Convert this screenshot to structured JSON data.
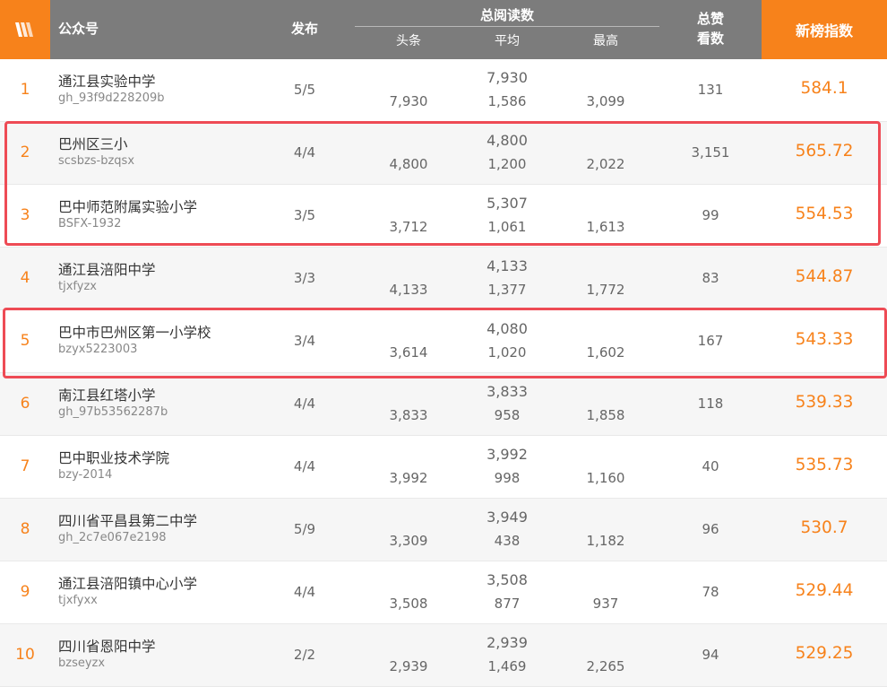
{
  "header": {
    "logo_icon": "w-logo-icon",
    "account_label": "公众号",
    "publish_label": "发布",
    "total_reads_label": "总阅读数",
    "headline_label": "头条",
    "average_label": "平均",
    "max_label": "最高",
    "likes_label_1": "总赞",
    "likes_label_2": "看数",
    "index_label": "新榜指数"
  },
  "colors": {
    "accent": "#f7821b",
    "header_bg": "#7c7c7c",
    "highlight": "#ee4b55"
  },
  "rows": [
    {
      "rank": "1",
      "name": "通江县实验中学",
      "account": "gh_93f9d228209b",
      "publish": "5/5",
      "total": "7,930",
      "headline": "7,930",
      "average": "1,586",
      "max": "3,099",
      "likes": "131",
      "score": "584.1"
    },
    {
      "rank": "2",
      "name": "巴州区三小",
      "account": "scsbzs-bzqsx",
      "publish": "4/4",
      "total": "4,800",
      "headline": "4,800",
      "average": "1,200",
      "max": "2,022",
      "likes": "3,151",
      "score": "565.72"
    },
    {
      "rank": "3",
      "name": "巴中师范附属实验小学",
      "account": "BSFX-1932",
      "publish": "3/5",
      "total": "5,307",
      "headline": "3,712",
      "average": "1,061",
      "max": "1,613",
      "likes": "99",
      "score": "554.53"
    },
    {
      "rank": "4",
      "name": "通江县涪阳中学",
      "account": "tjxfyzx",
      "publish": "3/3",
      "total": "4,133",
      "headline": "4,133",
      "average": "1,377",
      "max": "1,772",
      "likes": "83",
      "score": "544.87"
    },
    {
      "rank": "5",
      "name": "巴中市巴州区第一小学校",
      "account": "bzyx5223003",
      "publish": "3/4",
      "total": "4,080",
      "headline": "3,614",
      "average": "1,020",
      "max": "1,602",
      "likes": "167",
      "score": "543.33"
    },
    {
      "rank": "6",
      "name": "南江县红塔小学",
      "account": "gh_97b53562287b",
      "publish": "4/4",
      "total": "3,833",
      "headline": "3,833",
      "average": "958",
      "max": "1,858",
      "likes": "118",
      "score": "539.33"
    },
    {
      "rank": "7",
      "name": "巴中职业技术学院",
      "account": "bzy-2014",
      "publish": "4/4",
      "total": "3,992",
      "headline": "3,992",
      "average": "998",
      "max": "1,160",
      "likes": "40",
      "score": "535.73"
    },
    {
      "rank": "8",
      "name": "四川省平昌县第二中学",
      "account": "gh_2c7e067e2198",
      "publish": "5/9",
      "total": "3,949",
      "headline": "3,309",
      "average": "438",
      "max": "1,182",
      "likes": "96",
      "score": "530.7"
    },
    {
      "rank": "9",
      "name": "通江县涪阳镇中心小学",
      "account": "tjxfyxx",
      "publish": "4/4",
      "total": "3,508",
      "headline": "3,508",
      "average": "877",
      "max": "937",
      "likes": "78",
      "score": "529.44"
    },
    {
      "rank": "10",
      "name": "四川省恩阳中学",
      "account": "bzseyzx",
      "publish": "2/2",
      "total": "2,939",
      "headline": "2,939",
      "average": "1,469",
      "max": "2,265",
      "likes": "94",
      "score": "529.25"
    }
  ]
}
